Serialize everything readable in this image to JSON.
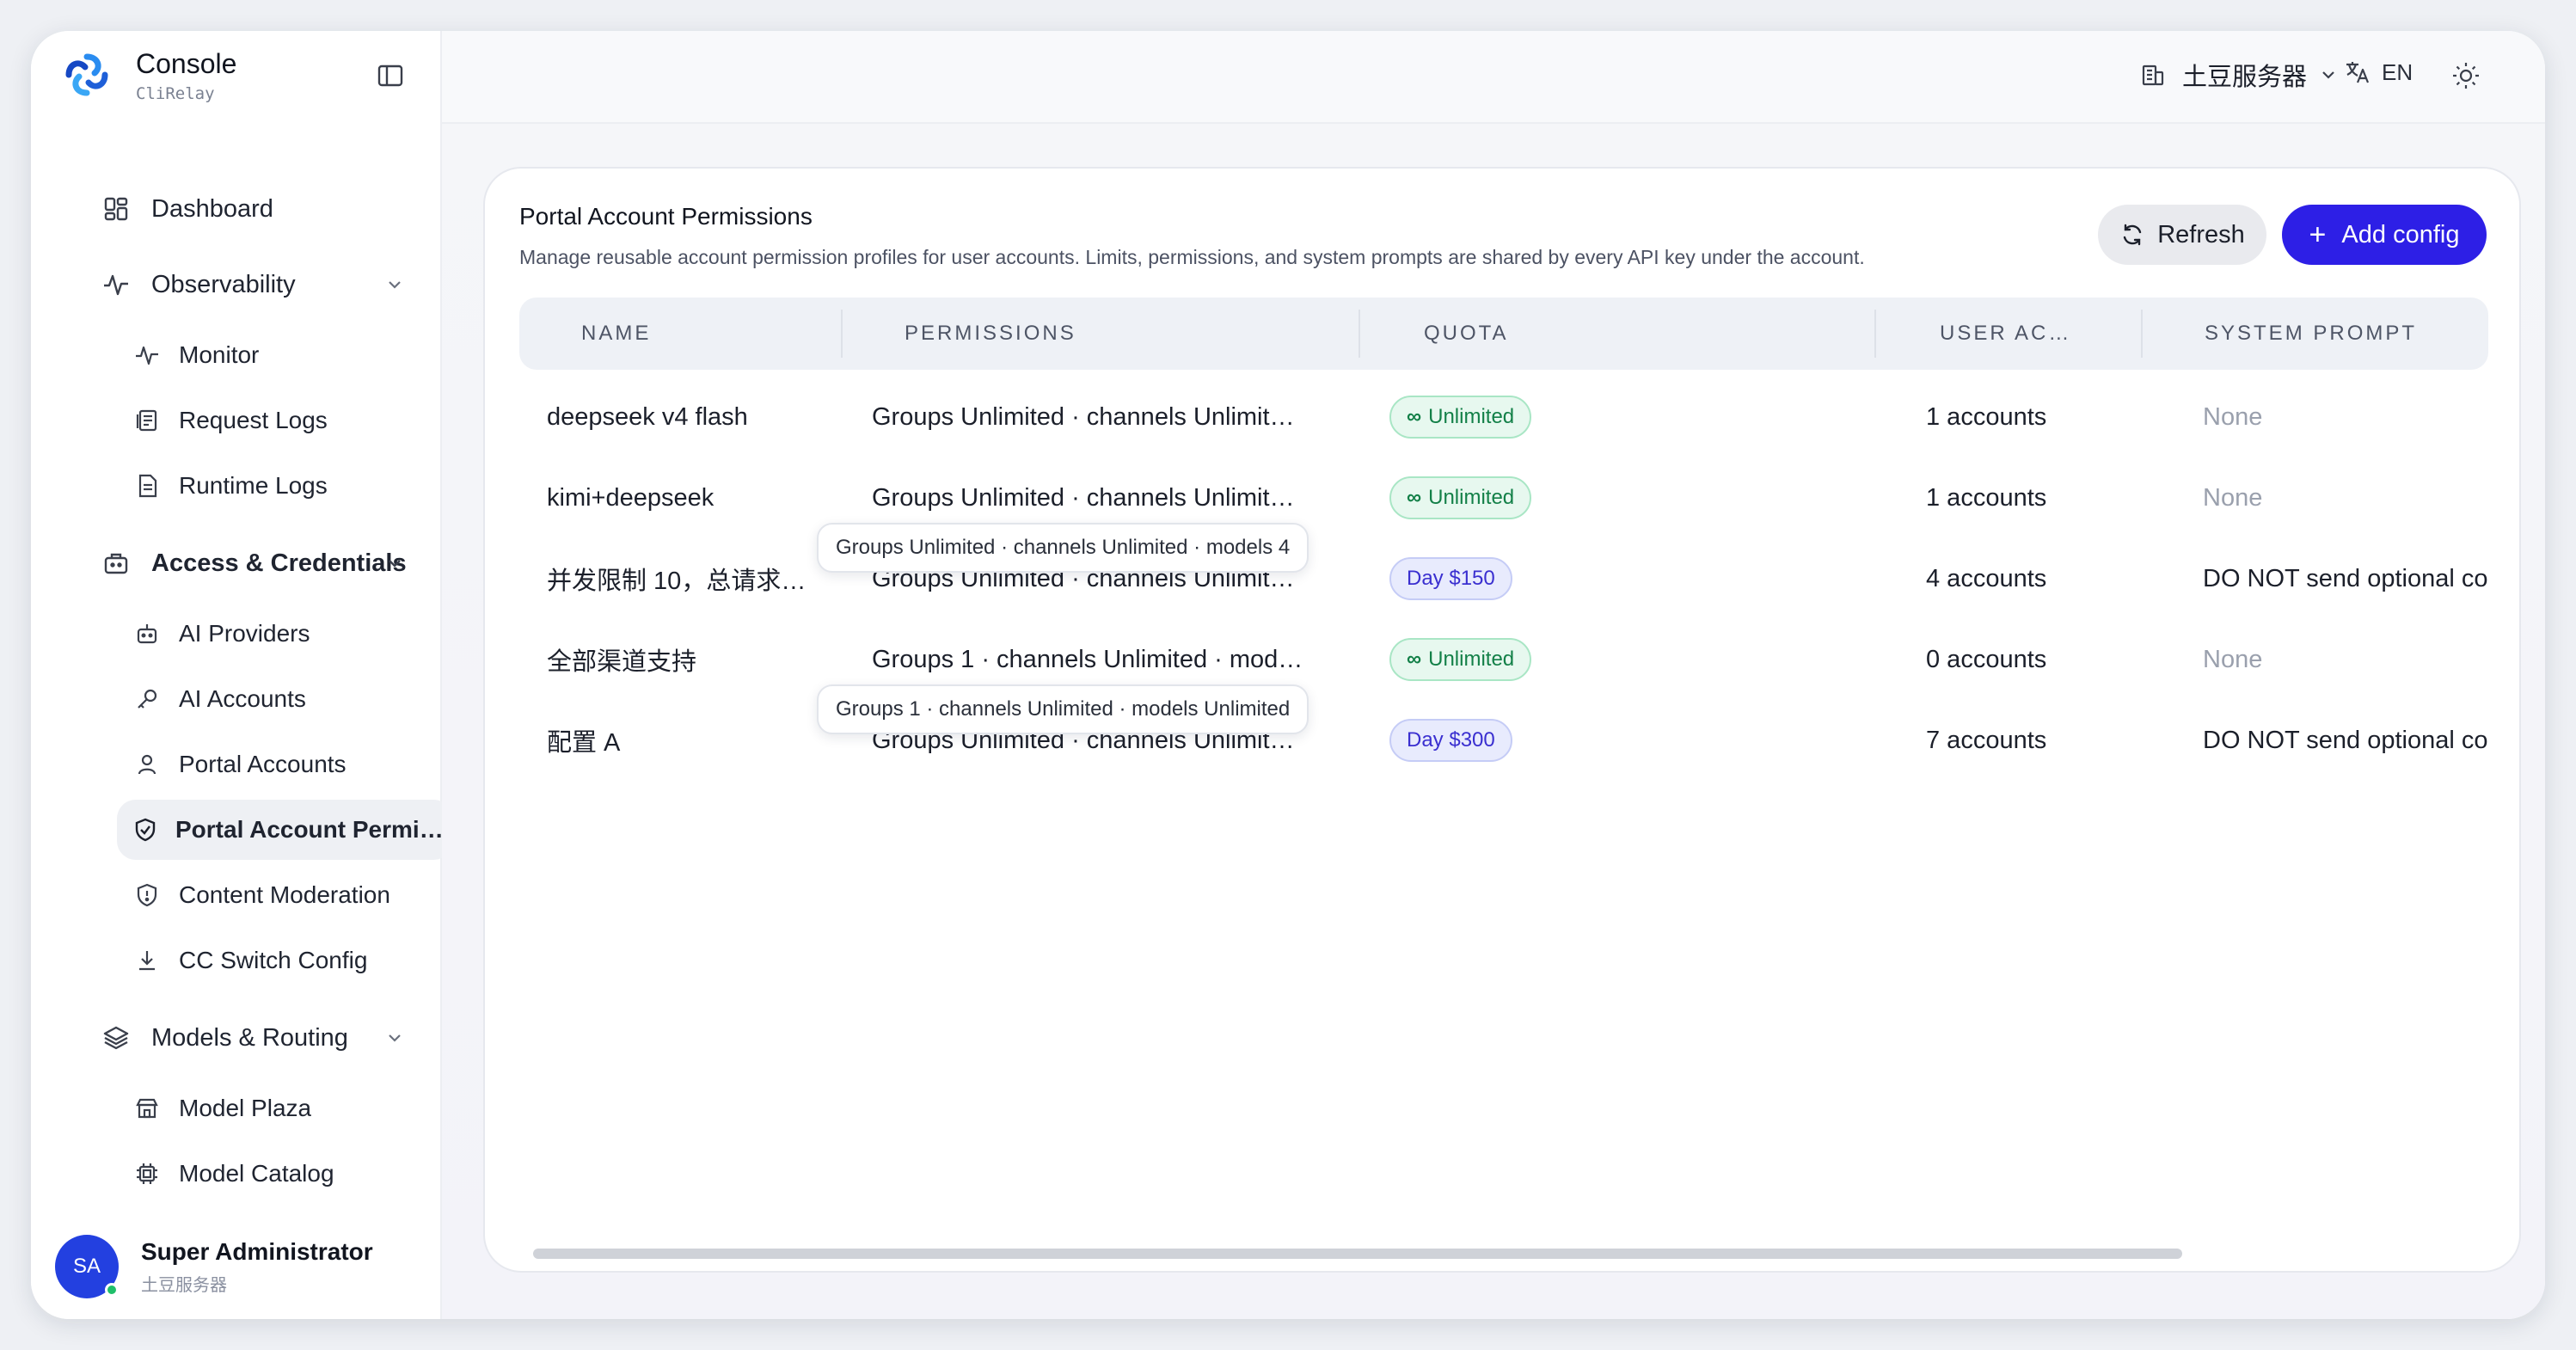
{
  "brand": {
    "title": "Console",
    "subtitle": "CliRelay"
  },
  "nav": {
    "dashboard": "Dashboard",
    "observability": "Observability",
    "monitor": "Monitor",
    "request_logs": "Request Logs",
    "runtime_logs": "Runtime Logs",
    "access": "Access & Credentials",
    "ai_providers": "AI Providers",
    "ai_accounts": "AI Accounts",
    "portal_accounts": "Portal Accounts",
    "portal_account_permissions": "Portal Account Permissions",
    "content_moderation": "Content Moderation",
    "cc_switch_config": "CC Switch Config",
    "models_routing": "Models & Routing",
    "model_plaza": "Model Plaza",
    "model_catalog": "Model Catalog"
  },
  "user": {
    "initials": "SA",
    "name": "Super Administrator",
    "org": "土豆服务器"
  },
  "topbar": {
    "server": "土豆服务器",
    "lang": "EN"
  },
  "card": {
    "title": "Portal Account Permissions",
    "description": "Manage reusable account permission profiles for user accounts. Limits, permissions, and system prompts are shared by every API key under the account.",
    "refresh_label": "Refresh",
    "add_label": "Add config"
  },
  "table": {
    "columns": [
      "NAME",
      "PERMISSIONS",
      "QUOTA",
      "USER AC…",
      "SYSTEM PROMPT"
    ],
    "rows": [
      {
        "name": "deepseek v4 flash",
        "permissions": "Groups Unlimited · channels Unlimit…",
        "quota": "Unlimited",
        "quota_kind": "unlimited",
        "accounts": "1 accounts",
        "prompt": "None",
        "prompt_muted": true
      },
      {
        "name": "kimi+deepseek",
        "permissions": "Groups Unlimited · channels Unlimit…",
        "quota": "Unlimited",
        "quota_kind": "unlimited",
        "accounts": "1 accounts",
        "prompt": "None",
        "prompt_muted": true
      },
      {
        "name": "并发限制 10，总请求…",
        "permissions": "Groups Unlimited · channels Unlimit…",
        "quota": "Day $150",
        "quota_kind": "limited",
        "accounts": "4 accounts",
        "prompt": "DO NOT send optional commer",
        "prompt_muted": false
      },
      {
        "name": "全部渠道支持",
        "permissions": "Groups 1 · channels Unlimited · mod…",
        "quota": "Unlimited",
        "quota_kind": "unlimited",
        "accounts": "0 accounts",
        "prompt": "None",
        "prompt_muted": true
      },
      {
        "name": "配置 A",
        "permissions": "Groups Unlimited · channels Unlimit…",
        "quota": "Day $300",
        "quota_kind": "limited",
        "accounts": "7 accounts",
        "prompt": "DO NOT send optional commer",
        "prompt_muted": false
      }
    ],
    "tooltips": [
      "Groups Unlimited · channels Unlimited · models 4",
      "Groups 1 · channels Unlimited · models Unlimited"
    ]
  },
  "colors": {
    "accent": "#2d1fe6",
    "green": "#138048",
    "avatar": "#2340e0"
  }
}
